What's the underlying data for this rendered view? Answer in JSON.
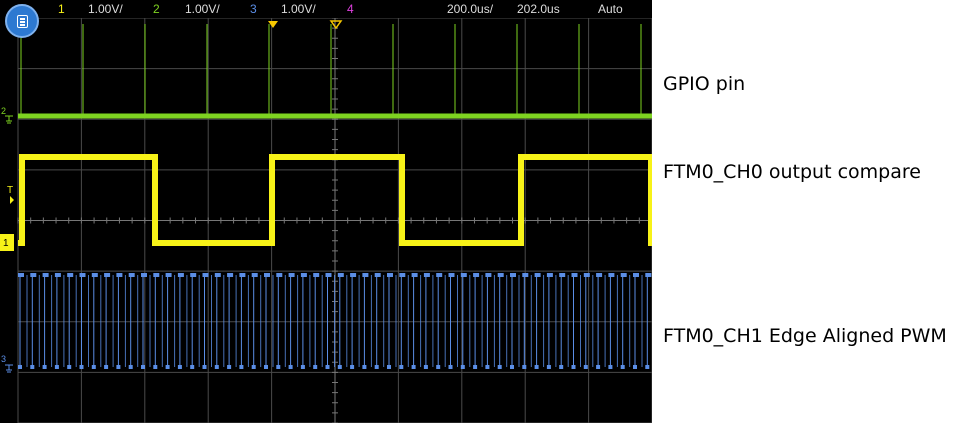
{
  "topbar": {
    "ch1_num": "1",
    "ch1_scale": "1.00V/",
    "ch2_num": "2",
    "ch2_scale": "1.00V/",
    "ch3_num": "3",
    "ch3_scale": "1.00V/",
    "ch4_num": "4",
    "timebase": "200.0us/",
    "delay": "202.0us",
    "trigger_mode": "Auto"
  },
  "markers": {
    "ch2_marker": "2",
    "trigger_marker": "T",
    "ch1_marker": "1",
    "ch3_marker": "3"
  },
  "annotations": {
    "gpio": "GPIO pin",
    "ch0": "FTM0_CH0 output compare",
    "ch1": "FTM0_CH1 Edge Aligned PWM"
  },
  "colors": {
    "ch1": "#f7f218",
    "ch2": "#7ed321",
    "ch3": "#5b8ee6",
    "ch4": "#e040e0",
    "grid": "#4a4a4a",
    "menu": "#2d79d1"
  },
  "icons": {
    "menu": "menu-icon"
  }
}
